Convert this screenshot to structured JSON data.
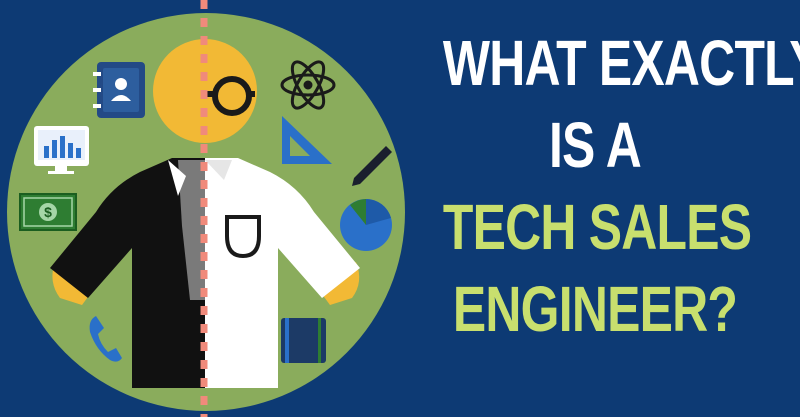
{
  "headline": {
    "lines": [
      "WHAT EXACTLY",
      "IS A",
      "TECH SALES",
      "ENGINEER?"
    ]
  },
  "colors": {
    "background": "#0d3a74",
    "circle": "#8aac5c",
    "highlight_text": "#c8df6e",
    "head": "#f2b935",
    "divider": "#f08a7b"
  },
  "icons": [
    "contact-book-icon",
    "monitor-chart-icon",
    "dollar-bill-icon",
    "phone-icon",
    "atom-icon",
    "set-square-icon",
    "pencil-icon",
    "pie-chart-icon",
    "notebook-icon",
    "glasses-icon"
  ]
}
